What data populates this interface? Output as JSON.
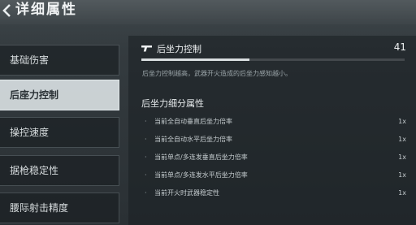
{
  "header": {
    "title": "详细属性"
  },
  "sidebar": {
    "items": [
      {
        "label": "基础伤害"
      },
      {
        "label": "后座力控制"
      },
      {
        "label": "操控速度"
      },
      {
        "label": "据枪稳定性"
      },
      {
        "label": "腰际射击精度"
      }
    ],
    "active_index": 1
  },
  "stat": {
    "name": "后坐力控制",
    "value": "41",
    "level_percent": 41,
    "description": "后坐力控制越高，武器开火造成的后坐力感知越小。"
  },
  "subattributes": {
    "heading": "后坐力细分属性",
    "rows": [
      {
        "bullet": "·",
        "name": "当前全自动垂直后坐力倍率",
        "multiplier": "1x"
      },
      {
        "bullet": "·",
        "name": "当前全自动水平后坐力倍率",
        "multiplier": "1x"
      },
      {
        "bullet": "·",
        "name": "当前单点/多连发垂直后坐力倍率",
        "multiplier": "1x"
      },
      {
        "bullet": "·",
        "name": "当前单点/多连发水平后坐力倍率",
        "multiplier": "1x"
      },
      {
        "bullet": "·",
        "name": "当前开火时武器稳定性",
        "multiplier": "1x"
      }
    ]
  },
  "icons": {
    "back": "back-arrow-icon",
    "stat": "pistol-icon"
  },
  "colors": {
    "active_tab_bg": "#d7dee1",
    "active_tab_text": "#2b3236",
    "bar_fill": "#d9dee0"
  }
}
